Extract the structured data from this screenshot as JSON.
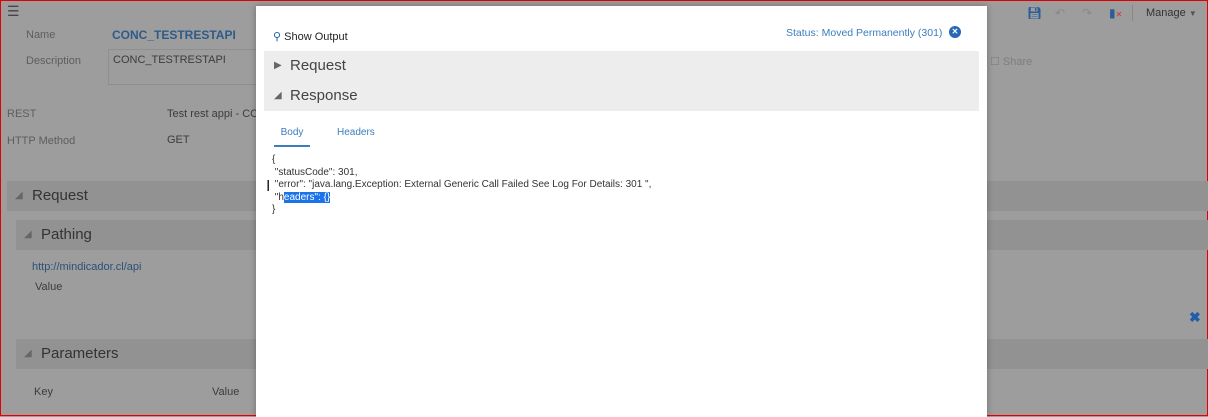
{
  "background": {
    "name_label": "Name",
    "name_value": "CONC_TESTRESTAPI",
    "description_label": "Description",
    "description_value": "CONC_TESTRESTAPI",
    "rest_label": "REST",
    "rest_value": "Test rest appi - CON",
    "method_label": "HTTP Method",
    "method_value": "GET",
    "request_section": "Request",
    "pathing_section": "Pathing",
    "url": "http://mindicador.cl/api",
    "value_label": "Value",
    "parameters_section": "Parameters",
    "key_col": "Key",
    "value_col": "Value",
    "share": "Share",
    "manage": "Manage"
  },
  "modal": {
    "title": "Show Output",
    "status": "Status: Moved Permanently (301)",
    "request": "Request",
    "response": "Response",
    "tabs": [
      "Body",
      "Headers"
    ],
    "body_lines": [
      "{",
      " \"statusCode\": 301,",
      " \"error\": \"java.lang.Exception: External Generic Call Failed See Log For Details: 301 \",",
      "}"
    ],
    "line4_pre": " \"h",
    "line4_sel": "eaders\": {}"
  }
}
